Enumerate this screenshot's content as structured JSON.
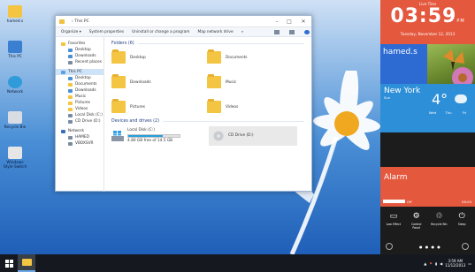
{
  "desktop_icons": [
    {
      "label": "hamed.s",
      "icon": "user-folder-icon"
    },
    {
      "label": "This PC",
      "icon": "computer-icon"
    },
    {
      "label": "Network",
      "icon": "network-icon"
    },
    {
      "label": "Recycle Bin",
      "icon": "recycle-bin-icon"
    },
    {
      "label": "Windows Style Switch",
      "icon": "app-icon"
    }
  ],
  "explorer": {
    "address": "›  This PC",
    "ribbon": {
      "organize": "Organize ▾",
      "properties": "System properties",
      "uninstall": "Uninstall or change a program",
      "map_drive": "Map network drive",
      "more": "»"
    },
    "nav": [
      {
        "label": "Favorites",
        "level": 0,
        "color": "#f4c542"
      },
      {
        "label": "Desktop",
        "level": 1,
        "color": "#4a8fd6"
      },
      {
        "label": "Downloads",
        "level": 1,
        "color": "#4a8fd6"
      },
      {
        "label": "Recent places",
        "level": 1,
        "color": "#7a8aa0"
      },
      {
        "label": "This PC",
        "level": 0,
        "color": "#5aa0e6",
        "selected": true
      },
      {
        "label": "Desktop",
        "level": 1,
        "color": "#4a8fd6"
      },
      {
        "label": "Documents",
        "level": 1,
        "color": "#f4c542"
      },
      {
        "label": "Downloads",
        "level": 1,
        "color": "#4a8fd6"
      },
      {
        "label": "Music",
        "level": 1,
        "color": "#f4c542"
      },
      {
        "label": "Pictures",
        "level": 1,
        "color": "#f4c542"
      },
      {
        "label": "Videos",
        "level": 1,
        "color": "#f4c542"
      },
      {
        "label": "Local Disk (C:)",
        "level": 1,
        "color": "#7a8aa0"
      },
      {
        "label": "CD Drive (D:)",
        "level": 1,
        "color": "#7a8aa0"
      },
      {
        "label": "Network",
        "level": 0,
        "color": "#3a6fb8"
      },
      {
        "label": "HAMED",
        "level": 1,
        "color": "#7a8aa0"
      },
      {
        "label": "VBOXSVR",
        "level": 1,
        "color": "#7a8aa0"
      }
    ],
    "folders_heading": "Folders (6)",
    "folders": [
      "Desktop",
      "Documents",
      "Downloads",
      "Music",
      "Pictures",
      "Videos"
    ],
    "drives_heading": "Devices and drives (2)",
    "drives": [
      {
        "name": "Local Disk (C:)",
        "free": "4.80 GB free of 14.5 GB",
        "used_fraction": 0.67
      },
      {
        "name": "CD Drive (D:)"
      }
    ]
  },
  "panel": {
    "clock_title": "Live Tiles",
    "time": "03:59",
    "ampm": "PM",
    "date": "Tuesday, November 12, 2013",
    "username": "hamed.s",
    "city": "New York",
    "weather_sub": "Sun",
    "temperature": "4°",
    "forecast": [
      "Wed",
      "Thu",
      "Fri"
    ],
    "alarm_title": "Alarm",
    "alarm_left": "Off",
    "alarm_right": "06:00",
    "quick": [
      {
        "label": "Low Effect",
        "icon": "monitor-icon"
      },
      {
        "label": "Control Panel",
        "icon": "gear-icon"
      },
      {
        "label": "Recycle Bin",
        "icon": "recycle-bin-icon"
      },
      {
        "label": "Sleep",
        "icon": "power-icon"
      }
    ]
  },
  "taskbar": {
    "time": "3:59 AM",
    "date": "11/12/2013"
  },
  "colors": {
    "accent_orange": "#e4583e",
    "accent_blue": "#2d6bd3",
    "weather_blue": "#2d8fd8",
    "taskbar": "#15191f"
  }
}
